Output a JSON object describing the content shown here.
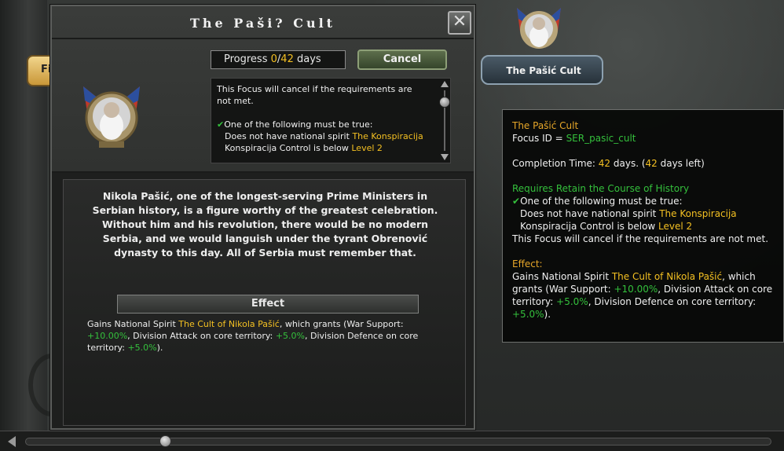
{
  "dialog": {
    "title": "The Paši? Cult",
    "close_icon": "close-icon",
    "progress": {
      "label": "Progress ",
      "current": "0",
      "separator": "/",
      "total": "42",
      "unit": " days"
    },
    "cancel_label": "Cancel",
    "requirements": {
      "line1": "This Focus will cancel if the requirements are not met.",
      "check_icon": "check-icon",
      "one_of": "One of the following must be true:",
      "cond1_prefix": "Does not have national spirit ",
      "cond1_value": "The Konspiracija",
      "cond2_prefix": "Konspiracija Control is below ",
      "cond2_value": "Level 2"
    },
    "description": "Nikola Pašić, one of the longest-serving Prime Ministers in Serbian history, is a figure worthy of the greatest celebration. Without him and his revolution, there would be no modern Serbia, and we would languish under the tyrant Obrenović dynasty to this day. All of Serbia must remember that.",
    "effect_header": "Effect",
    "effect": {
      "prefix": "Gains National Spirit ",
      "spirit": "The Cult of Nikola Pašić",
      "mid": ", which grants (War Support: ",
      "ws": "+10.00%",
      "mid2": ", Division Attack on core territory: ",
      "atk": "+5.0%",
      "mid3": ", Division Defence on core territory: ",
      "def": "+5.0%",
      "suffix": ")."
    }
  },
  "focus_node": {
    "label": "The Pašić Cult"
  },
  "left_button": {
    "label": "Fi"
  },
  "tooltip": {
    "title": "The Pašić Cult",
    "focus_id_label": "Focus ID = ",
    "focus_id": "SER_pasic_cult",
    "completion_prefix": "Completion Time: ",
    "completion_days": "42",
    "completion_mid": " days. (",
    "days_left": "42",
    "completion_suffix": " days left)",
    "requires": "Requires Retain the Course of History",
    "one_of": "One of the following must be true:",
    "cond1_prefix": "Does not have national spirit ",
    "cond1_value": "The Konspiracija",
    "cond2_prefix": "Konspiracija Control is below ",
    "cond2_value": "Level 2",
    "cancel_note": "This Focus will cancel if the requirements are not met.",
    "effect_label": "Effect:",
    "effect_prefix": "Gains National Spirit ",
    "effect_spirit": "The Cult of Nikola Pašić",
    "effect_mid": ", which grants (War Support: ",
    "ws": "+10.00%",
    "effect_mid2": ", Division Attack on core territory: ",
    "atk": "+5.0%",
    "effect_mid3": ", Division Defence on core territory: ",
    "def": "+5.0%",
    "effect_suffix": ")."
  },
  "colors": {
    "highlight_yellow": "#f4c022",
    "highlight_green": "#34c03c",
    "highlight_orange": "#e6a629"
  }
}
